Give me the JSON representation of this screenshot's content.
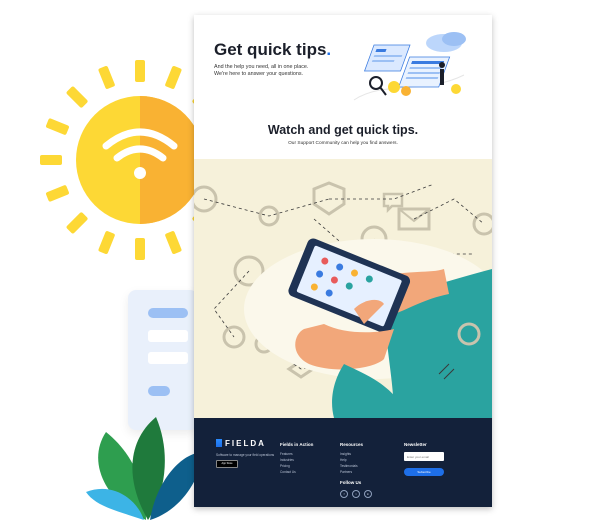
{
  "hero": {
    "title": "Get quick tips",
    "title_dot": ".",
    "subtitle": "And the help you need, all in one place. We're here to answer your questions."
  },
  "watch": {
    "title": "Watch and get quick tips.",
    "subtitle": "Our Support Community can help you find answers."
  },
  "footer": {
    "brand": "FIELDA",
    "tagline": "Software to manage your field operations",
    "store_badge": "App Store",
    "columns": [
      {
        "title": "Fields in Action",
        "links": [
          "Features",
          "Industries",
          "Pricing",
          "Contact Us"
        ]
      },
      {
        "title": "Resources",
        "links": [
          "Insights",
          "Help",
          "Testimonials",
          "Partners"
        ]
      }
    ],
    "follow_title": "Follow Us",
    "social": [
      {
        "icon": "facebook-icon",
        "glyph": "f"
      },
      {
        "icon": "twitter-icon",
        "glyph": "t"
      },
      {
        "icon": "linkedin-icon",
        "glyph": "in"
      }
    ],
    "newsletter": {
      "title": "Newsletter",
      "placeholder": "Enter your email",
      "button": "Subscribe"
    }
  },
  "colors": {
    "accent": "#1e6fe8",
    "footer_bg": "#13213a",
    "scene_bg": "#f6f1da",
    "sun": "#fdd835",
    "teal_sleeve": "#2aa3a0"
  }
}
